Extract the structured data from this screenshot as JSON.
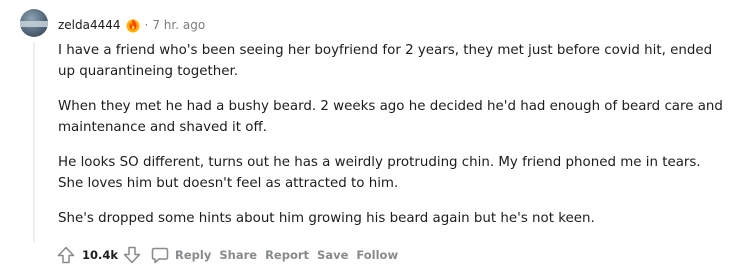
{
  "comment": {
    "username": "zelda4444",
    "timestamp": "7 hr. ago",
    "separator": "·",
    "flair_icon": "flame-award-icon",
    "paragraphs": [
      "I have a friend who's been seeing her boyfriend for 2 years, they met just before covid hit, ended up quarantineing together.",
      "When they met he had a bushy beard. 2 weeks ago he decided he'd had enough of beard care and maintenance and shaved it off.",
      "He looks SO different, turns out he has a weirdly protruding chin. My friend phoned me in tears. She loves him but doesn't feel as attracted to him.",
      "She's dropped some hints about him growing his beard again but he's not keen."
    ]
  },
  "actions": {
    "score": "10.4k",
    "reply_label": "Reply",
    "share_label": "Share",
    "report_label": "Report",
    "save_label": "Save",
    "follow_label": "Follow"
  }
}
